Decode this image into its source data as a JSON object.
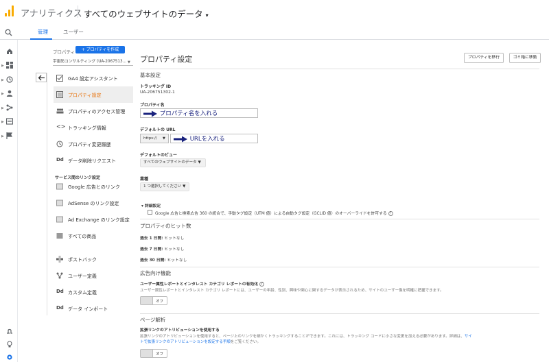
{
  "header": {
    "app_title": "アナリティクス",
    "view_selector": "すべてのウェブサイトのデータ",
    "view_selector_caret": "▾"
  },
  "tabs": [
    {
      "label": "管理"
    },
    {
      "label": "ユーザー"
    }
  ],
  "property_column": {
    "label": "プロパティ",
    "create_button": "+ プロパティを作成",
    "selected_property": "宇宙防コンサルティング (UA-2067513..."
  },
  "nav": {
    "items": [
      {
        "label": "GA4 設定アシスタント",
        "icon": "checkbox-icon"
      },
      {
        "label": "プロパティ設定",
        "icon": "property-settings-icon"
      },
      {
        "label": "プロパティのアクセス管理",
        "icon": "people-icon"
      },
      {
        "label": "トラッキング情報",
        "icon": "code-icon"
      },
      {
        "label": "プロパティ変更履歴",
        "icon": "history-icon"
      },
      {
        "label": "データ削除リクエスト",
        "icon": "dd-icon",
        "glyph": "Dd"
      }
    ],
    "link_section_head": "サービス間のリンク設定",
    "link_items": [
      {
        "label": "Google 広告とのリンク",
        "icon": "google-ads-icon"
      },
      {
        "label": "AdSense のリンク設定",
        "icon": "adsense-icon"
      },
      {
        "label": "Ad Exchange のリンク設定",
        "icon": "ad-exchange-icon"
      },
      {
        "label": "すべての商品",
        "icon": "all-products-icon"
      }
    ],
    "other_items": [
      {
        "label": "ポストバック",
        "icon": "postback-icon"
      },
      {
        "label": "ユーザー定義",
        "icon": "user-defined-icon"
      },
      {
        "label": "カスタム定義",
        "icon": "dd-icon",
        "glyph": "Dd"
      },
      {
        "label": "データ インポート",
        "icon": "dd-icon",
        "glyph": "Dd"
      }
    ]
  },
  "main": {
    "title": "プロパティ設定",
    "move_property_button": "プロパティを移行",
    "trash_button": "ゴミ箱に移動",
    "basic_settings": "基本設定",
    "tracking_id_label": "トラッキング ID",
    "tracking_id_value": "UA-206751302-1",
    "property_name_label": "プロパティ名",
    "property_name_note": "プロパティ名を入れる",
    "default_url_label": "デフォルトの URL",
    "url_protocol": "https://",
    "url_note": "URLを入れる",
    "default_view_label": "デフォルトのビュー",
    "default_view_value": "すべてのウェブサイトのデータ",
    "industry_label": "業種",
    "industry_value": "1 つ選択してください",
    "advanced_settings": "詳細設定",
    "advanced_checkbox_text": "Google 広告と検索広告 360 の統合で、手動タグ設定（UTM 値）による自動タグ設定（GCLID 値）のオーバーライドを許可する",
    "hits_title": "プロパティのヒット数",
    "hits": [
      {
        "label": "過去 1 日間:",
        "value": "ヒットなし"
      },
      {
        "label": "過去 7 日間:",
        "value": "ヒットなし"
      },
      {
        "label": "過去 30 日間:",
        "value": "ヒットなし"
      }
    ],
    "ad_features_title": "広告向け機能",
    "demographics_label": "ユーザー属性レポートとインタレスト カテゴリ レポートの有効化",
    "demographics_desc": "ユーザー属性レポートとインタレスト カテゴリ レポートには、ユーザーの年齢、性別、興味や関心に関するデータが表示されるため、サイトのユーザー像を明確に把握できます。",
    "toggle_off_1": "オフ",
    "page_analysis_title": "ページ解析",
    "enhanced_link_label": "拡張リンクのアトリビューションを使用する",
    "enhanced_link_desc": "拡張リンクのアトリビューションを使用すると、ページ上のリンクを細かくトラッキングすることができます。これには、トラッキング コードに小さな変更を加える必要があります。詳細は、",
    "enhanced_link_desc_link1": "サイ",
    "enhanced_link_desc_link2": "トで拡張リンクのアトリビューションを設定する手順",
    "enhanced_link_desc_end": "をご覧ください。",
    "toggle_off_2": "オフ"
  },
  "colors": {
    "brand_orange": "#f9ab00",
    "accent_blue": "#1a73e8",
    "active_nav_text": "#e8710a"
  }
}
